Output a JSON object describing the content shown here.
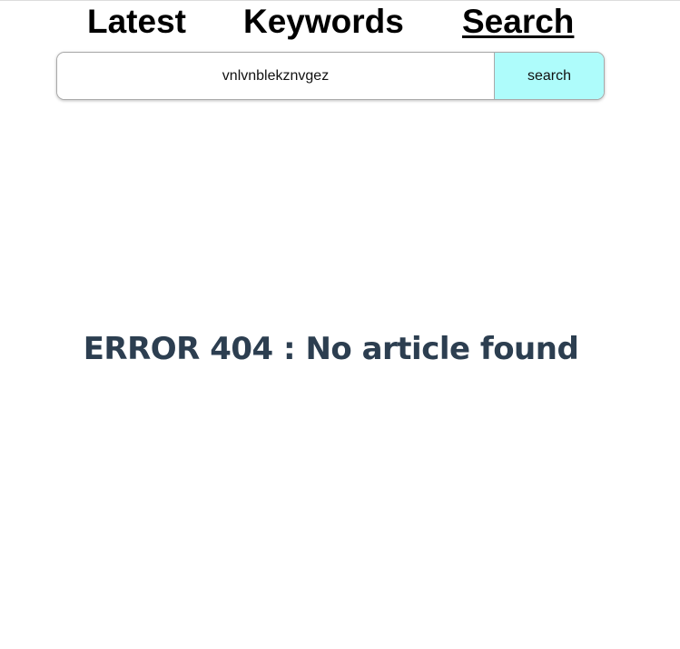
{
  "nav": {
    "items": [
      {
        "label": "Latest",
        "active": false
      },
      {
        "label": "Keywords",
        "active": false
      },
      {
        "label": "Search",
        "active": true
      }
    ]
  },
  "search": {
    "value": "vnlvnblekznvgez",
    "button_label": "search",
    "button_color": "#aefcfb"
  },
  "main": {
    "error_message": "ERROR 404 : No article found",
    "error_color": "#2c3e50"
  }
}
